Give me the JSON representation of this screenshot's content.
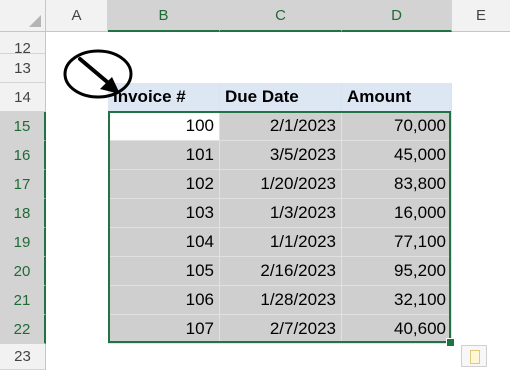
{
  "columns": [
    "A",
    "B",
    "C",
    "D",
    "E"
  ],
  "rows": [
    "12",
    "13",
    "14",
    "15",
    "16",
    "17",
    "18",
    "19",
    "20",
    "21",
    "22",
    "23"
  ],
  "table": {
    "headers": [
      "Invoice #",
      "Due Date",
      "Amount"
    ],
    "records": [
      [
        "100",
        "2/1/2023",
        "70,000"
      ],
      [
        "101",
        "3/5/2023",
        "45,000"
      ],
      [
        "102",
        "1/20/2023",
        "83,800"
      ],
      [
        "103",
        "1/3/2023",
        "16,000"
      ],
      [
        "104",
        "1/1/2023",
        "77,100"
      ],
      [
        "105",
        "2/16/2023",
        "95,200"
      ],
      [
        "106",
        "1/28/2023",
        "32,100"
      ],
      [
        "107",
        "2/7/2023",
        "40,600"
      ]
    ]
  },
  "selection": {
    "range": "B15:D22",
    "active_cell": "B15"
  },
  "colors": {
    "accent": "#217346",
    "header_fill": "#dde6f3",
    "range_fill": "#cfcfcf"
  },
  "icons": {
    "annotation": "arrow-circle-icon",
    "paste": "paste-options-icon"
  }
}
